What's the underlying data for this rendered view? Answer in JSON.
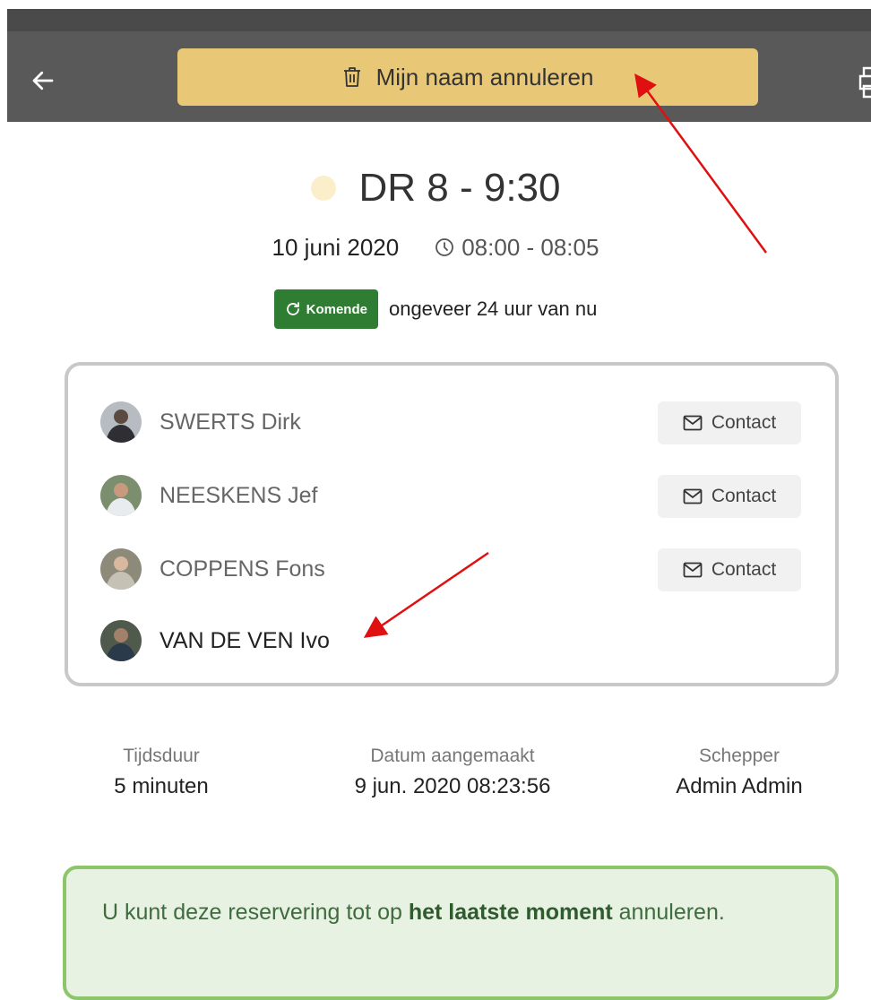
{
  "toolbar": {
    "back_icon": "arrow-left-icon",
    "cancel_label": "Mijn naam annuleren",
    "cancel_icon": "trash-icon",
    "print_icon": "printer-icon",
    "button_color": "#e8c876"
  },
  "reservation": {
    "title": "DR 8 - 9:30",
    "status_dot_color": "#fbeeca",
    "date": "10 juni 2020",
    "time": "08:00 - 08:05",
    "status_badge": "Komende",
    "status_badge_color": "#2e7d32",
    "relative_time": "ongeveer 24 uur van nu"
  },
  "players": [
    {
      "name": "SWERTS Dirk",
      "contact_label": "Contact"
    },
    {
      "name": "NEESKENS Jef",
      "contact_label": "Contact"
    },
    {
      "name": "COPPENS Fons",
      "contact_label": "Contact"
    },
    {
      "name": "VAN DE VEN Ivo"
    }
  ],
  "info": [
    {
      "label": "Tijdsduur",
      "value": "5 minuten"
    },
    {
      "label": "Datum aangemaakt",
      "value": "9 jun. 2020 08:23:56"
    },
    {
      "label": "Schepper",
      "value": "Admin Admin"
    }
  ],
  "notice": {
    "prefix": "U kunt deze reservering tot op ",
    "bold": "het laatste moment",
    "suffix": " annuleren."
  }
}
